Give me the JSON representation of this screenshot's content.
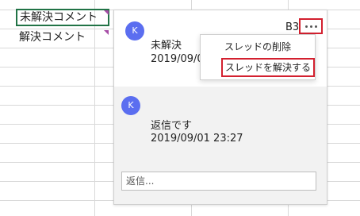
{
  "sheet": {
    "cells": [
      "未解決コメント",
      "解決コメント"
    ]
  },
  "comment_panel": {
    "cell_ref": "B3",
    "thread": [
      {
        "avatar_initial": "K",
        "text": "未解決",
        "timestamp": "2019/09/01"
      },
      {
        "avatar_initial": "K",
        "text": "返信です",
        "timestamp": "2019/09/01 23:27"
      }
    ],
    "reply_placeholder": "返信..."
  },
  "context_menu": {
    "items": [
      "スレッドの削除",
      "スレッドを解決する"
    ]
  },
  "colors": {
    "selection_border": "#217346",
    "highlight_red": "#d3202f",
    "avatar_blue": "#5b6ef0",
    "comment_indicator": "#a64ca6"
  }
}
